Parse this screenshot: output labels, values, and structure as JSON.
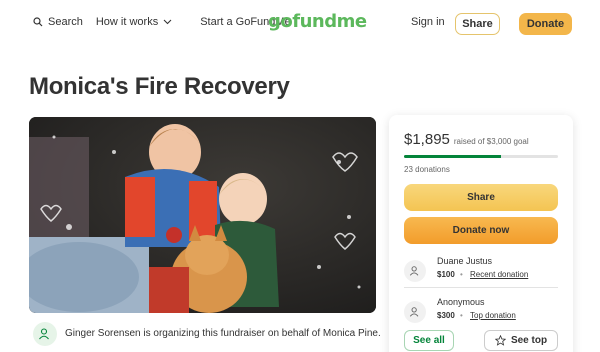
{
  "header": {
    "search_label": "Search",
    "how_it_works_label": "How it works",
    "start_label": "Start a GoFundMe",
    "logo_text": "gofundme",
    "signin_label": "Sign in",
    "share_label": "Share",
    "donate_label": "Donate"
  },
  "campaign": {
    "title": "Monica's Fire Recovery",
    "organizer_text": "Ginger Sorensen is organizing this fundraiser on behalf of Monica Pine."
  },
  "card": {
    "raised_amount": "$1,895",
    "goal_text": "raised of $3,000 goal",
    "progress_fraction": 0.63,
    "donations_count": "23 donations",
    "share_label": "Share",
    "donate_now_label": "Donate now",
    "donors": [
      {
        "name": "Duane Justus",
        "amount": "$100",
        "tag": "Recent donation"
      },
      {
        "name": "Anonymous",
        "amount": "$300",
        "tag": "Top donation"
      }
    ],
    "see_all_label": "See all",
    "see_top_label": "See top"
  },
  "colors": {
    "brand_green": "#04843a",
    "logo_green": "#5cb85c",
    "share_yellow": "#f4c452",
    "donate_orange": "#f29c2b"
  },
  "icons": [
    "search-icon",
    "chevron-down-icon",
    "user-heart-icon",
    "star-icon"
  ]
}
